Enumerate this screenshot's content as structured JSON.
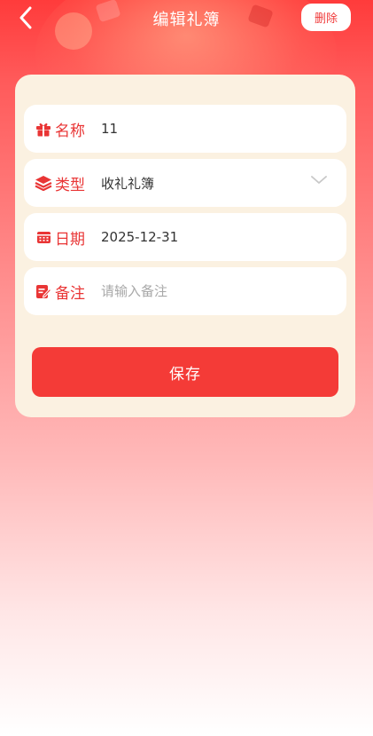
{
  "nav": {
    "title": "编辑礼簿",
    "delete_label": "删除",
    "back_icon": "chevron-left-icon"
  },
  "form": {
    "name": {
      "label": "名称",
      "value": "11",
      "icon": "gift-icon"
    },
    "type": {
      "label": "类型",
      "value": "收礼礼簿",
      "icon": "layers-icon"
    },
    "date": {
      "label": "日期",
      "value": "2025-12-31",
      "icon": "calendar-icon"
    },
    "note": {
      "label": "备注",
      "placeholder": "请输入备注",
      "value": "",
      "icon": "edit-note-icon"
    }
  },
  "save_label": "保存",
  "colors": {
    "accent": "#f43b37",
    "card_bg": "#fbf1e1",
    "label_red": "#e93535"
  }
}
